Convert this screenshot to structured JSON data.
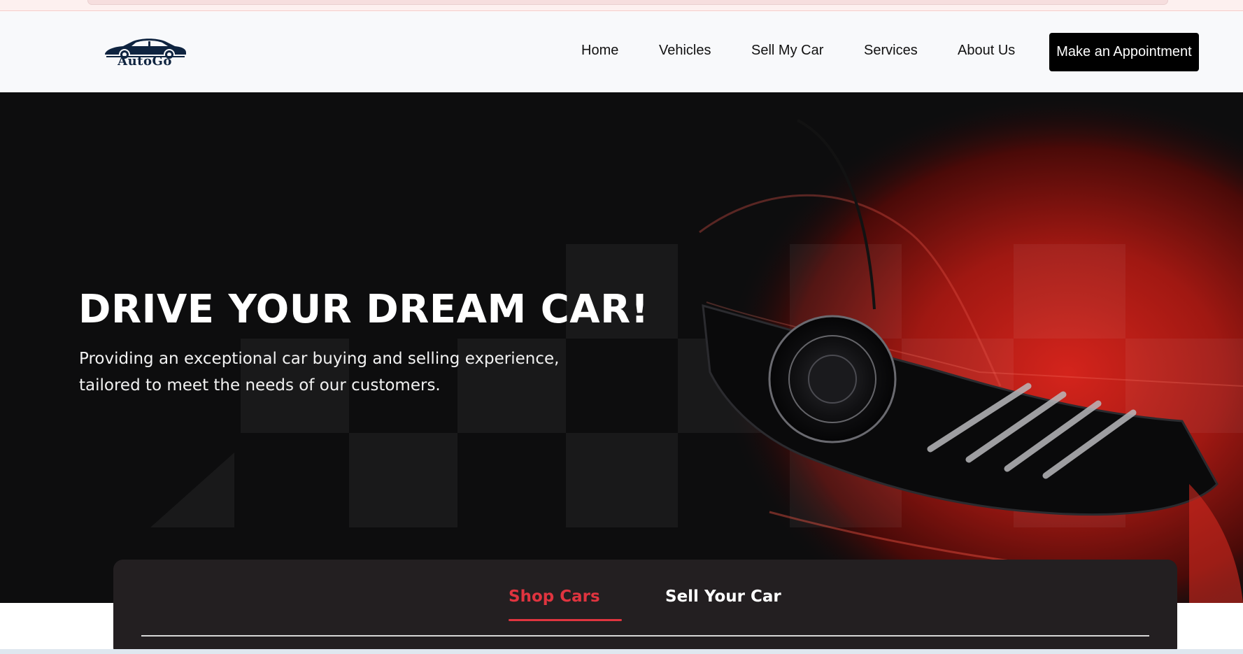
{
  "brand": {
    "logo_text": "AutoGo",
    "logo_color": "#0f2440"
  },
  "nav": {
    "items": [
      {
        "label": "Home"
      },
      {
        "label": "Vehicles"
      },
      {
        "label": "Sell My Car"
      },
      {
        "label": "Services"
      },
      {
        "label": "About Us"
      }
    ],
    "cta_label": "Make an Appointment"
  },
  "hero": {
    "title": "DRIVE YOUR DREAM CAR!",
    "subtitle": "Providing an exceptional car buying and selling experience, tailored to meet the needs of our customers."
  },
  "search_tabs": {
    "tabs": [
      {
        "label": "Shop Cars",
        "active": true
      },
      {
        "label": "Sell Your Car",
        "active": false
      }
    ]
  },
  "colors": {
    "accent": "#e0343f",
    "hero_background": "#0d0d0e",
    "card_background": "#231f21",
    "cta_background": "#000000"
  },
  "icons": {
    "logo": "car-logo-icon"
  }
}
